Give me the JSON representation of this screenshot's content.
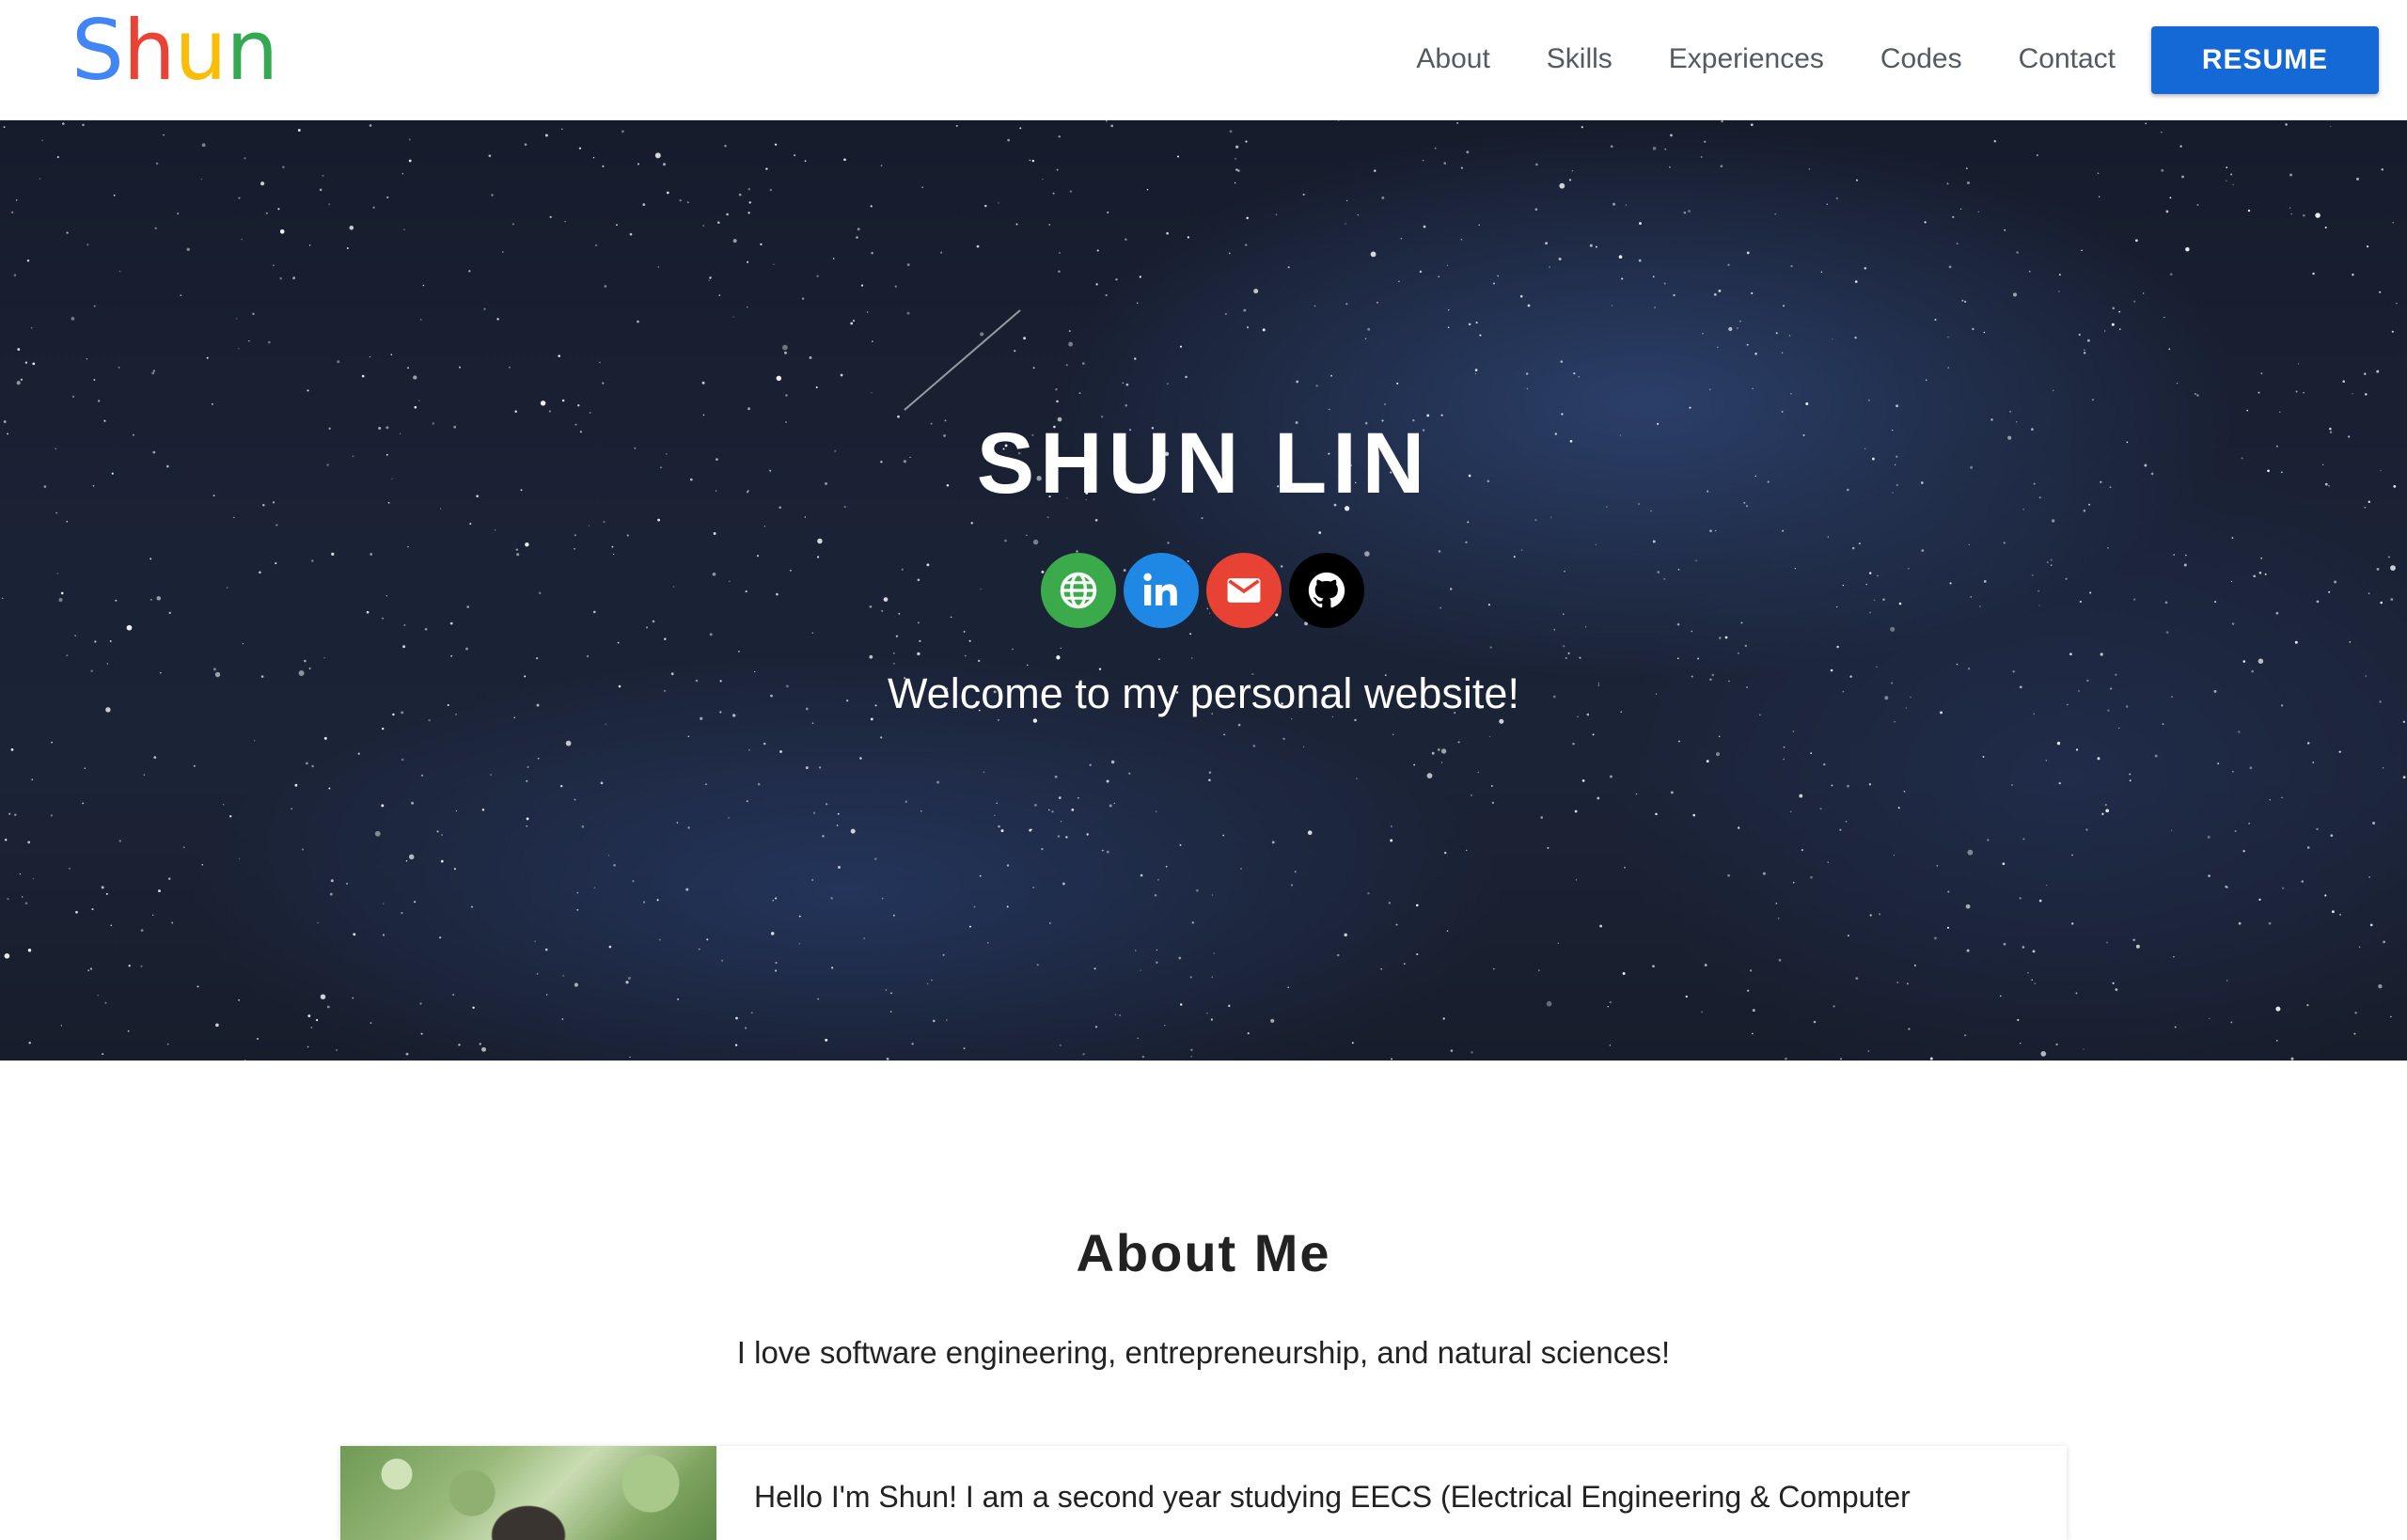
{
  "navbar": {
    "logo": {
      "letters": [
        {
          "char": "S",
          "color": "#4285F4"
        },
        {
          "char": "h",
          "color": "#EA4335"
        },
        {
          "char": "u",
          "color": "#FBBC05"
        },
        {
          "char": "n",
          "color": "#34A853"
        }
      ]
    },
    "links": [
      "About",
      "Skills",
      "Experiences",
      "Codes",
      "Contact"
    ],
    "resume_label": "RESUME",
    "accent": "#1469d6"
  },
  "hero": {
    "title": "SHUN LIN",
    "welcome": "Welcome to my personal website!",
    "socials": [
      {
        "icon": "globe-icon",
        "color": "#3aaa4b"
      },
      {
        "icon": "linkedin-icon",
        "color": "#1f88e5"
      },
      {
        "icon": "mail-icon",
        "color": "#e84234"
      },
      {
        "icon": "github-icon",
        "color": "#000000"
      }
    ]
  },
  "about": {
    "title": "About Me",
    "subtitle": "I love software engineering, entrepreneurship, and natural sciences!",
    "intro": "Hello I'm Shun! I am a second year studying EECS (Electrical Engineering & Computer"
  }
}
